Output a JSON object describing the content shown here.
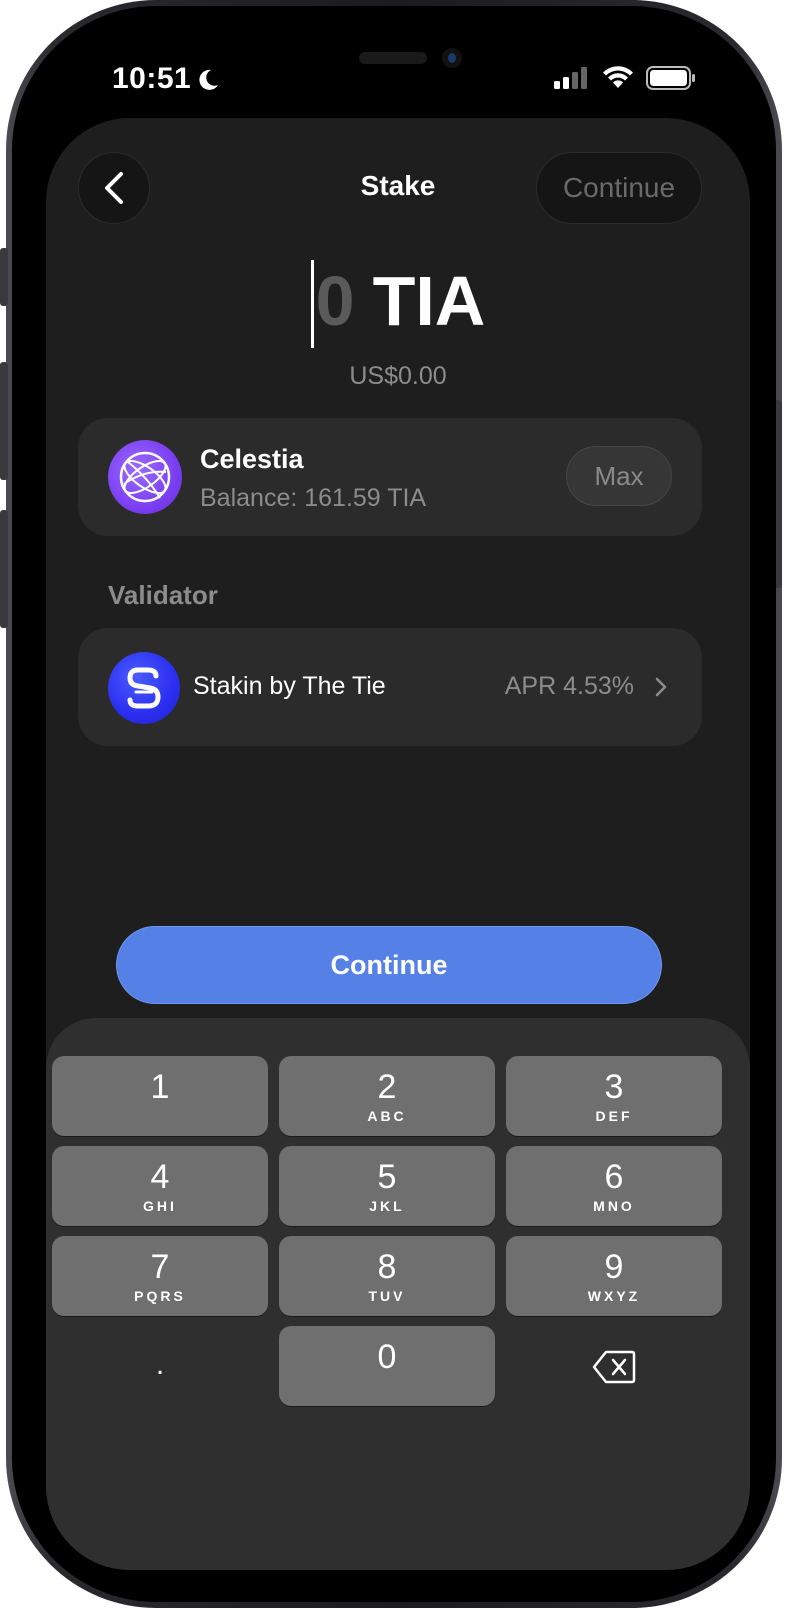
{
  "status": {
    "time": "10:51"
  },
  "header": {
    "title": "Stake",
    "continue_label": "Continue"
  },
  "amount": {
    "value": "0",
    "unit": "TIA",
    "fiat": "US$0.00"
  },
  "token": {
    "name": "Celestia",
    "balance": "Balance: 161.59 TIA",
    "max_label": "Max"
  },
  "validator": {
    "section_label": "Validator",
    "name": "Stakin by The Tie",
    "apr": "APR 4.53%"
  },
  "primary": {
    "continue_label": "Continue"
  },
  "keypad": {
    "k1": {
      "digit": "1",
      "letters": ""
    },
    "k2": {
      "digit": "2",
      "letters": "ABC"
    },
    "k3": {
      "digit": "3",
      "letters": "DEF"
    },
    "k4": {
      "digit": "4",
      "letters": "GHI"
    },
    "k5": {
      "digit": "5",
      "letters": "JKL"
    },
    "k6": {
      "digit": "6",
      "letters": "MNO"
    },
    "k7": {
      "digit": "7",
      "letters": "PQRS"
    },
    "k8": {
      "digit": "8",
      "letters": "TUV"
    },
    "k9": {
      "digit": "9",
      "letters": "WXYZ"
    },
    "k0": {
      "digit": "0",
      "letters": ""
    },
    "decimal": "."
  },
  "colors": {
    "accent": "#5580e6",
    "token_logo": "#7b3ff2",
    "validator_logo": "#2a2ef0"
  },
  "icons": [
    "moon-icon",
    "cellular-signal-icon",
    "wifi-icon",
    "battery-icon",
    "back-chevron-icon",
    "celestia-logo-icon",
    "stakin-logo-icon",
    "chevron-right-icon",
    "backspace-icon"
  ]
}
